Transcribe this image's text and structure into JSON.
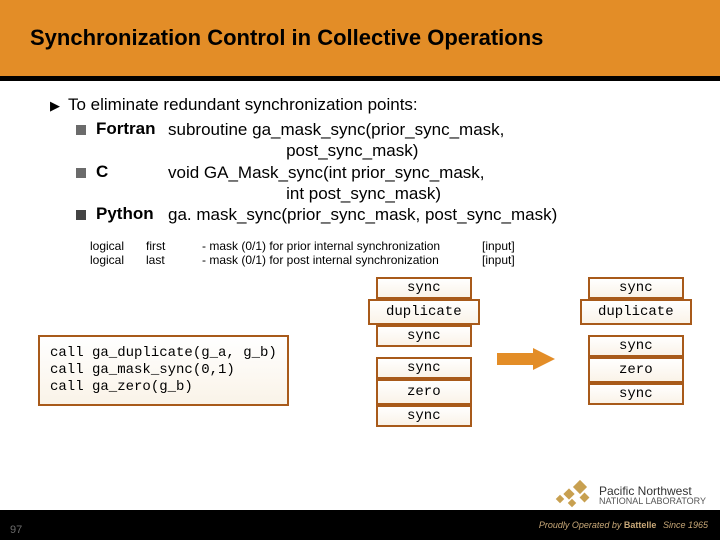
{
  "title": "Synchronization Control in Collective Operations",
  "bullet_main": "To eliminate redundant synchronization points:",
  "langs": {
    "fortran": {
      "name": "Fortran",
      "sig1": "subroutine ga_mask_sync(prior_sync_mask,",
      "sig2": "post_sync_mask)"
    },
    "c": {
      "name": "C",
      "sig1": "void GA_Mask_sync(int prior_sync_mask,",
      "sig2": "int post_sync_mask)"
    },
    "python": {
      "name": "Python",
      "sig1": "ga. mask_sync(prior_sync_mask, post_sync_mask)"
    }
  },
  "params": [
    {
      "type": "logical",
      "name": "first",
      "desc": "- mask (0/1) for prior internal synchronization",
      "io": "[input]"
    },
    {
      "type": "logical",
      "name": "last",
      "desc": "- mask (0/1) for post internal synchronization",
      "io": "[input]"
    }
  ],
  "code": {
    "l1": "call ga_duplicate(g_a, g_b)",
    "l2": "call ga_mask_sync(0,1)",
    "l3": "call ga_zero(g_b)"
  },
  "nodes": {
    "sync": "sync",
    "dup": "duplicate",
    "zero": "zero"
  },
  "footer": {
    "brand1": "Pacific Northwest",
    "brand2": "NATIONAL LABORATORY",
    "op": "Proudly Operated by",
    "bat": "Battelle",
    "since": "Since 1965"
  },
  "slide_no": "97"
}
